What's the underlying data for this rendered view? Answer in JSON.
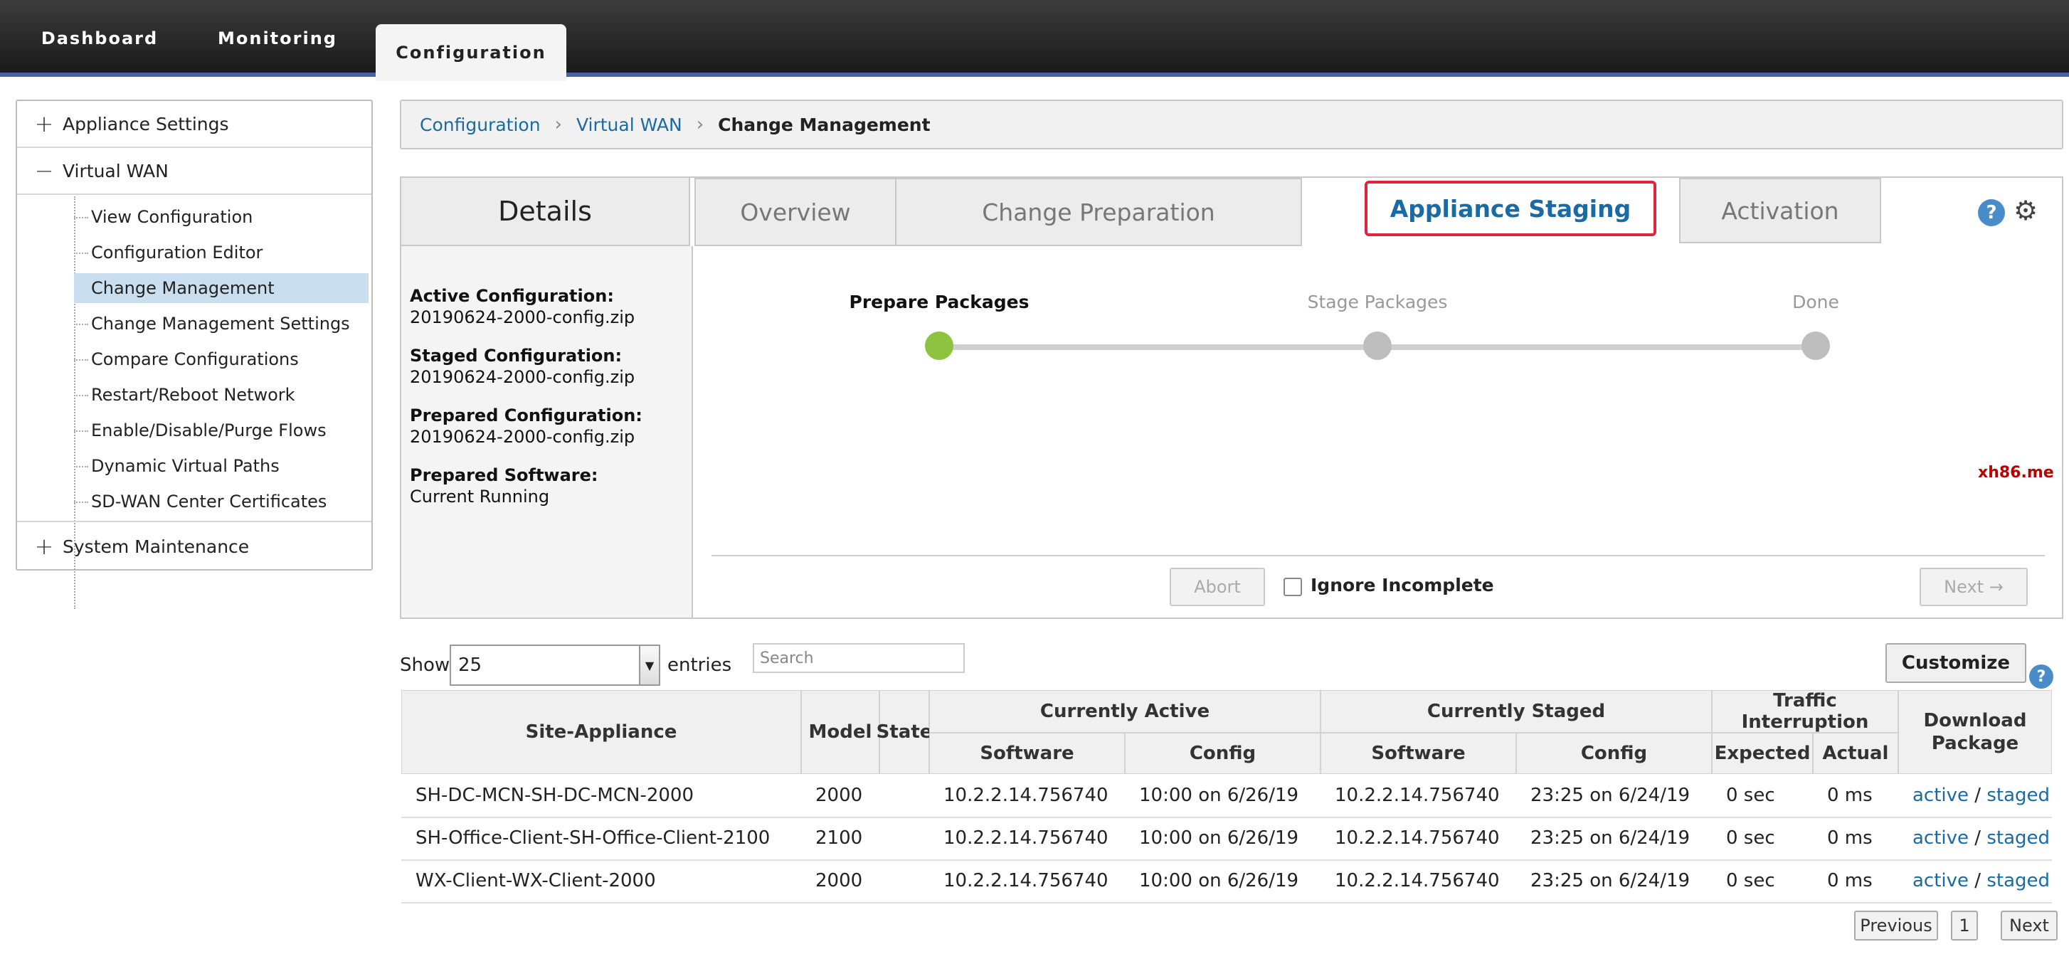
{
  "topnav": {
    "tabs": [
      "Dashboard",
      "Monitoring",
      "Configuration"
    ],
    "active": "Configuration"
  },
  "sidebar": {
    "sections": [
      {
        "sign": "+",
        "label": "Appliance Settings"
      },
      {
        "sign": "−",
        "label": "Virtual WAN"
      },
      {
        "sign": "+",
        "label": "System Maintenance"
      }
    ],
    "items": [
      "View Configuration",
      "Configuration Editor",
      "Change Management",
      "Change Management Settings",
      "Compare Configurations",
      "Restart/Reboot Network",
      "Enable/Disable/Purge Flows",
      "Dynamic Virtual Paths",
      "SD-WAN Center Certificates"
    ],
    "selected": "Change Management"
  },
  "breadcrumb": {
    "items": [
      "Configuration",
      "Virtual WAN"
    ],
    "current": "Change Management"
  },
  "details": {
    "title": "Details",
    "fields": [
      {
        "label": "Active Configuration:",
        "value": "20190624-2000-config.zip"
      },
      {
        "label": "Staged Configuration:",
        "value": "20190624-2000-config.zip"
      },
      {
        "label": "Prepared Configuration:",
        "value": "20190624-2000-config.zip"
      },
      {
        "label": "Prepared Software:",
        "value": "Current Running"
      }
    ]
  },
  "tabs": {
    "overview": "Overview",
    "change_preparation": "Change Preparation",
    "appliance_staging": "Appliance Staging",
    "activation": "Activation",
    "active": "Appliance Staging"
  },
  "steps": [
    {
      "label": "Prepare Packages",
      "state": "current"
    },
    {
      "label": "Stage Packages",
      "state": "pending"
    },
    {
      "label": "Done",
      "state": "pending"
    }
  ],
  "watermark": "xh86.me",
  "actions": {
    "abort": "Abort",
    "ignore_incomplete": "Ignore Incomplete",
    "ignore_checked": false,
    "next": "Next →"
  },
  "table_controls": {
    "show": "Show",
    "entries_value": "25",
    "entries": "entries",
    "search_placeholder": "Search",
    "customize": "Customize"
  },
  "table": {
    "headers": {
      "site_appliance": "Site-Appliance",
      "model": "Model",
      "state": "State",
      "currently_active": "Currently Active",
      "currently_staged": "Currently Staged",
      "traffic_interruption": "Traffic Interruption",
      "download_package": "Download Package",
      "software": "Software",
      "config": "Config",
      "expected": "Expected",
      "actual": "Actual"
    },
    "rows": [
      {
        "site": "SH-DC-MCN-SH-DC-MCN-2000",
        "model": "2000",
        "state": "",
        "active_sw": "10.2.2.14.756740",
        "active_cfg": "10:00 on 6/26/19",
        "staged_sw": "10.2.2.14.756740",
        "staged_cfg": "23:25 on 6/24/19",
        "expected": "0 sec",
        "actual": "0 ms",
        "dl_active": "active",
        "dl_sep": "/",
        "dl_staged": "staged"
      },
      {
        "site": "SH-Office-Client-SH-Office-Client-2100",
        "model": "2100",
        "state": "",
        "active_sw": "10.2.2.14.756740",
        "active_cfg": "10:00 on 6/26/19",
        "staged_sw": "10.2.2.14.756740",
        "staged_cfg": "23:25 on 6/24/19",
        "expected": "0 sec",
        "actual": "0 ms",
        "dl_active": "active",
        "dl_sep": "/",
        "dl_staged": "staged"
      },
      {
        "site": "WX-Client-WX-Client-2000",
        "model": "2000",
        "state": "",
        "active_sw": "10.2.2.14.756740",
        "active_cfg": "10:00 on 6/26/19",
        "staged_sw": "10.2.2.14.756740",
        "staged_cfg": "23:25 on 6/24/19",
        "expected": "0 sec",
        "actual": "0 ms",
        "dl_active": "active",
        "dl_sep": "/",
        "dl_staged": "staged"
      }
    ]
  },
  "pagination": {
    "previous": "Previous",
    "page": "1",
    "next": "Next"
  },
  "icons": {
    "help": "help-icon",
    "settings": "gear-icon",
    "dropdown": "chevron-down-icon"
  },
  "colors": {
    "accent": "#1a6aa4",
    "highlight_border": "#e0243e",
    "step_current": "#8dc43f",
    "selected_bg": "#c9dff0"
  }
}
